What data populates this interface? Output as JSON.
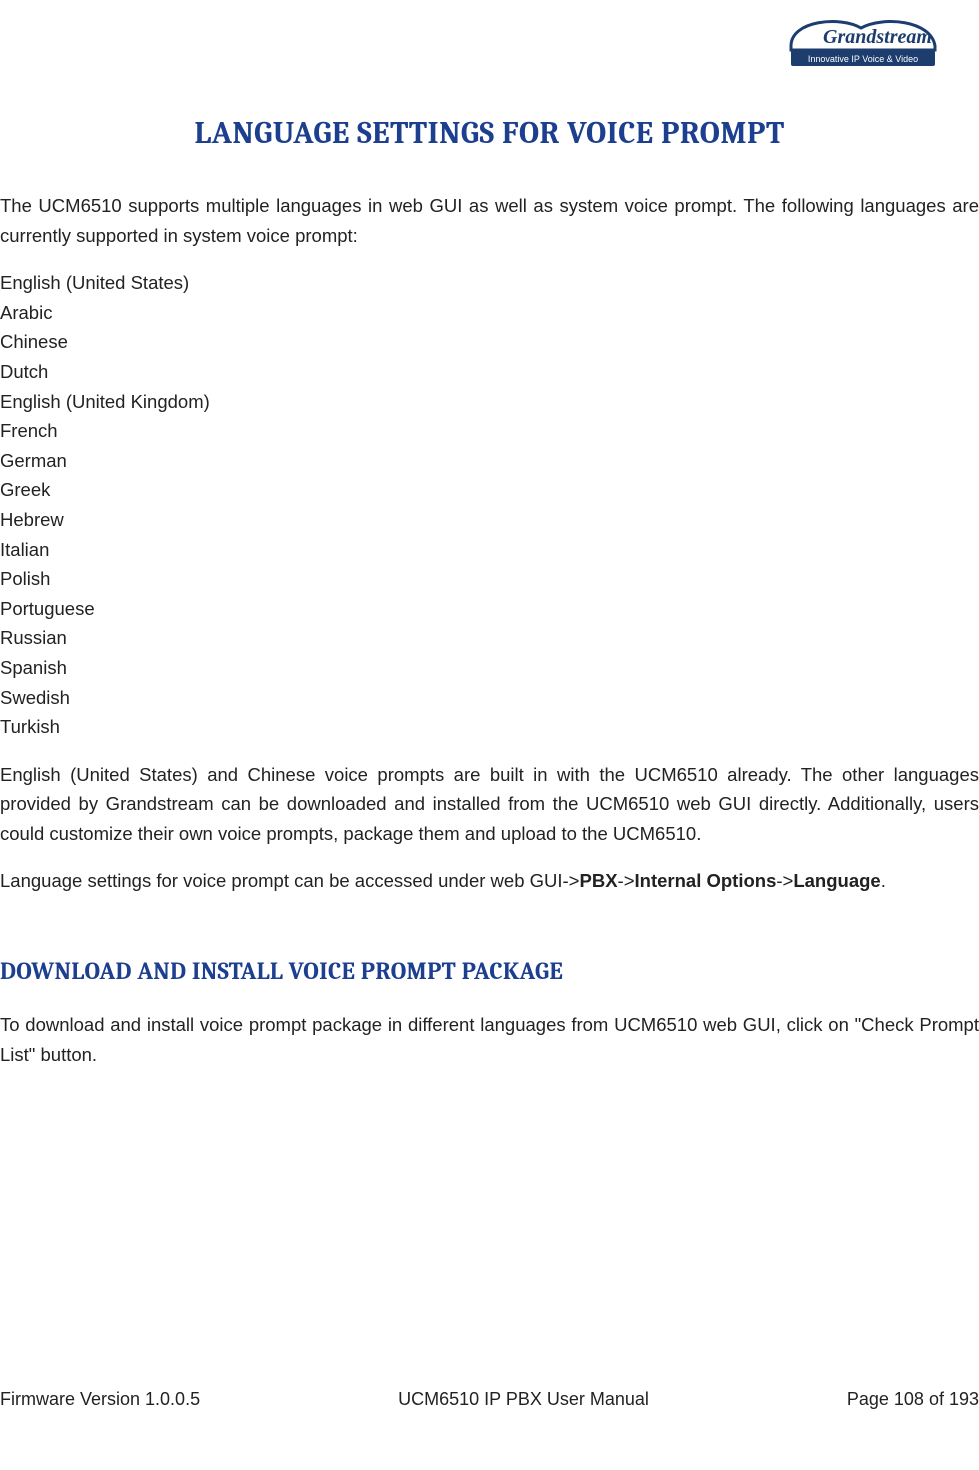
{
  "logo": {
    "brand": "Grandstream",
    "tagline": "Innovative IP Voice & Video"
  },
  "heading": "LANGUAGE SETTINGS FOR VOICE PROMPT",
  "intro": "The UCM6510 supports multiple languages in web GUI as well as system voice prompt. The following languages are currently supported in system voice prompt:",
  "languages": [
    "English (United States)",
    "Arabic",
    "Chinese",
    "Dutch",
    "English (United Kingdom)",
    "French",
    "German",
    "Greek",
    "Hebrew",
    "Italian",
    "Polish",
    "Portuguese",
    "Russian",
    "Spanish",
    "Swedish",
    "Turkish"
  ],
  "para2": "English (United States) and Chinese voice prompts are built in with the UCM6510 already. The other languages provided by Grandstream can be downloaded and installed from the UCM6510 web GUI directly. Additionally, users could customize their own voice prompts, package them and upload to the UCM6510.",
  "nav": {
    "prefix": "Language settings for voice prompt can be accessed under web GUI->",
    "b1": "PBX",
    "sep1": "->",
    "b2": "Internal Options",
    "sep2": "->",
    "b3": "Language",
    "suffix": "."
  },
  "subheading": "DOWNLOAD AND INSTALL VOICE PROMPT PACKAGE",
  "para3": "To download and install voice prompt package in different languages from UCM6510 web GUI, click on \"Check Prompt List\" button.",
  "footer": {
    "left": "Firmware Version 1.0.0.5",
    "center": "UCM6510 IP PBX User Manual",
    "right": "Page 108 of 193"
  }
}
